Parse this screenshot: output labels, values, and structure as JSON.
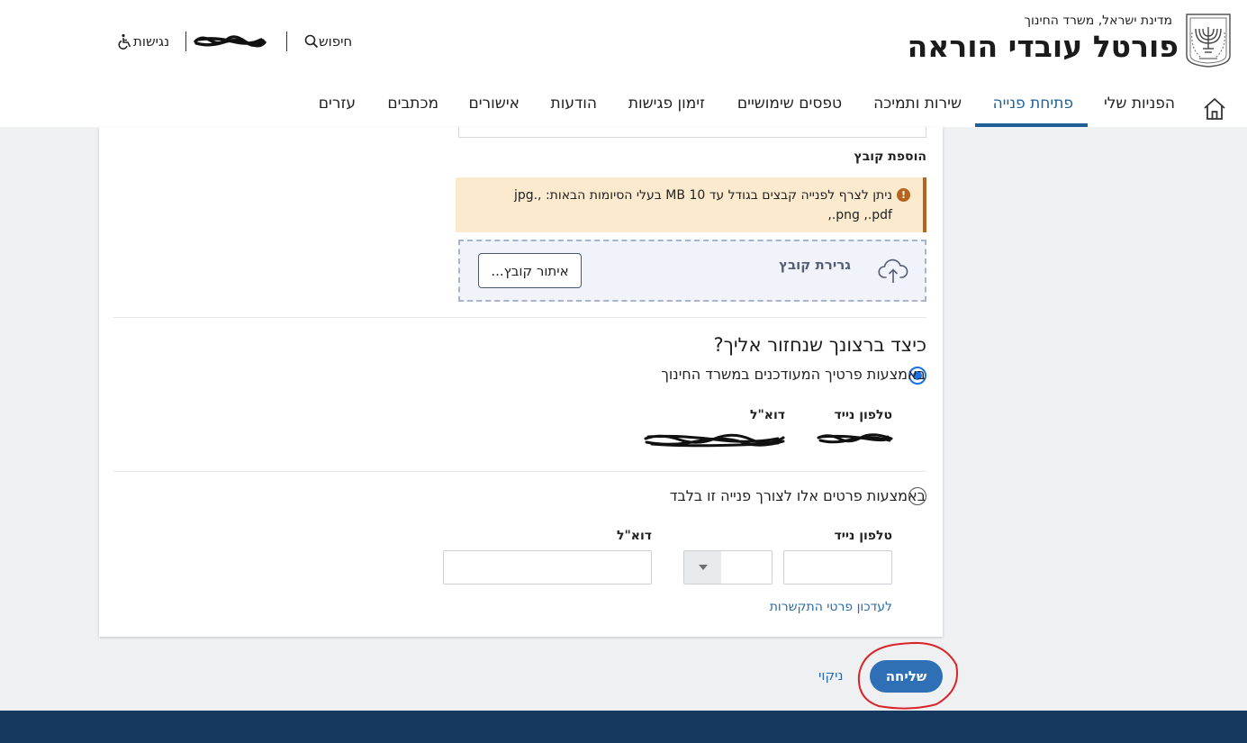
{
  "header": {
    "ministry_line": "מדינת ישראל, משרד החינוך",
    "portal_title": "פורטל עובדי הוראה",
    "search_label": "חיפוש",
    "accessibility_label": "נגישות"
  },
  "nav": {
    "items": [
      {
        "label": "הפניות שלי"
      },
      {
        "label": "פתיחת פנייה",
        "active": true
      },
      {
        "label": "שירות ותמיכה"
      },
      {
        "label": "טפסים שימושיים"
      },
      {
        "label": "זימון פגישות"
      },
      {
        "label": "הודעות"
      },
      {
        "label": "אישורים"
      },
      {
        "label": "מכתבים"
      },
      {
        "label": "עזרים"
      }
    ]
  },
  "attachment": {
    "section_label": "הוספת קובץ",
    "warning_text": "ניתן לצרף לפנייה קבצים בגודל עד 10 MB בעלי הסיומות הבאות: ,.jpg ,.png ,.pdf",
    "drag_label": "גרירת קובץ",
    "browse_label": "איתור קובץ..."
  },
  "contact": {
    "question": "כיצד ברצונך שנחזור אליך?",
    "option_existing": {
      "label": "באמצעות פרטיך המעודכנים במשרד החינוך",
      "checked": true,
      "phone_label": "טלפון נייד",
      "email_label": "דוא\"ל"
    },
    "option_custom": {
      "label": "באמצעות פרטים אלו לצורך פנייה זו בלבד",
      "checked": false,
      "phone_label": "טלפון נייד",
      "email_label": "דוא\"ל",
      "phone_value": "",
      "prefix_value": "",
      "email_value": ""
    },
    "update_link": "לעדכון פרטי התקשרות"
  },
  "actions": {
    "send_label": "שליחה",
    "clear_label": "ניקוי"
  },
  "colors": {
    "primary": "#2f6fb5",
    "nav_active": "#1f5f95",
    "warning_bg": "#fbeace",
    "warning_border": "#b5651d",
    "footer": "#163a5f",
    "annotation": "#d9242a"
  }
}
